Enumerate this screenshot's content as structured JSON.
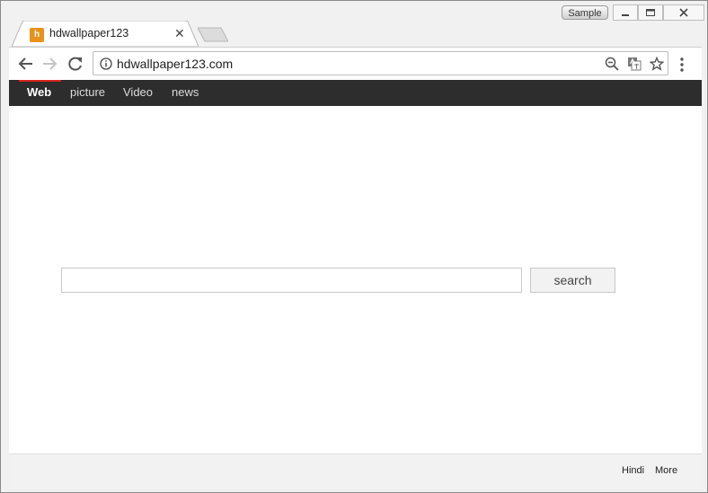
{
  "window": {
    "sample_label": "Sample"
  },
  "tab": {
    "title": "hdwallpaper123",
    "favicon_letter": "h"
  },
  "address_bar": {
    "url": "hdwallpaper123.com"
  },
  "site_nav": {
    "items": [
      "Web",
      "picture",
      "Video",
      "news"
    ],
    "active": "Web",
    "accent_color": "#d9251d"
  },
  "search": {
    "input_value": "",
    "button_label": "search"
  },
  "footer": {
    "links": [
      "Hindi",
      "More"
    ]
  },
  "icons": [
    "minimize-icon",
    "maximize-icon",
    "close-icon",
    "favicon-icon",
    "tab-close-icon",
    "back-icon",
    "forward-icon",
    "reload-icon",
    "info-icon",
    "zoom-out-icon",
    "translate-icon",
    "bookmark-star-icon",
    "menu-icon"
  ]
}
